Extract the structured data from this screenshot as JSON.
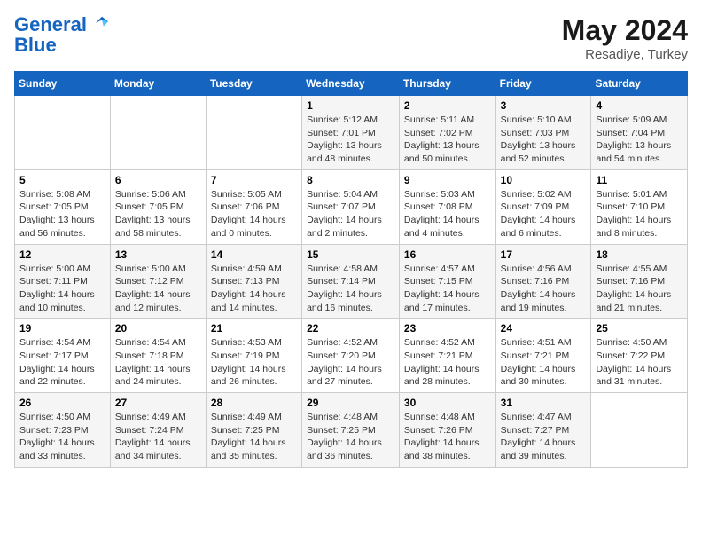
{
  "header": {
    "logo_line1": "General",
    "logo_line2": "Blue",
    "month": "May 2024",
    "location": "Resadiye, Turkey"
  },
  "weekdays": [
    "Sunday",
    "Monday",
    "Tuesday",
    "Wednesday",
    "Thursday",
    "Friday",
    "Saturday"
  ],
  "weeks": [
    [
      {
        "day": "",
        "info": ""
      },
      {
        "day": "",
        "info": ""
      },
      {
        "day": "",
        "info": ""
      },
      {
        "day": "1",
        "info": "Sunrise: 5:12 AM\nSunset: 7:01 PM\nDaylight: 13 hours\nand 48 minutes."
      },
      {
        "day": "2",
        "info": "Sunrise: 5:11 AM\nSunset: 7:02 PM\nDaylight: 13 hours\nand 50 minutes."
      },
      {
        "day": "3",
        "info": "Sunrise: 5:10 AM\nSunset: 7:03 PM\nDaylight: 13 hours\nand 52 minutes."
      },
      {
        "day": "4",
        "info": "Sunrise: 5:09 AM\nSunset: 7:04 PM\nDaylight: 13 hours\nand 54 minutes."
      }
    ],
    [
      {
        "day": "5",
        "info": "Sunrise: 5:08 AM\nSunset: 7:05 PM\nDaylight: 13 hours\nand 56 minutes."
      },
      {
        "day": "6",
        "info": "Sunrise: 5:06 AM\nSunset: 7:05 PM\nDaylight: 13 hours\nand 58 minutes."
      },
      {
        "day": "7",
        "info": "Sunrise: 5:05 AM\nSunset: 7:06 PM\nDaylight: 14 hours\nand 0 minutes."
      },
      {
        "day": "8",
        "info": "Sunrise: 5:04 AM\nSunset: 7:07 PM\nDaylight: 14 hours\nand 2 minutes."
      },
      {
        "day": "9",
        "info": "Sunrise: 5:03 AM\nSunset: 7:08 PM\nDaylight: 14 hours\nand 4 minutes."
      },
      {
        "day": "10",
        "info": "Sunrise: 5:02 AM\nSunset: 7:09 PM\nDaylight: 14 hours\nand 6 minutes."
      },
      {
        "day": "11",
        "info": "Sunrise: 5:01 AM\nSunset: 7:10 PM\nDaylight: 14 hours\nand 8 minutes."
      }
    ],
    [
      {
        "day": "12",
        "info": "Sunrise: 5:00 AM\nSunset: 7:11 PM\nDaylight: 14 hours\nand 10 minutes."
      },
      {
        "day": "13",
        "info": "Sunrise: 5:00 AM\nSunset: 7:12 PM\nDaylight: 14 hours\nand 12 minutes."
      },
      {
        "day": "14",
        "info": "Sunrise: 4:59 AM\nSunset: 7:13 PM\nDaylight: 14 hours\nand 14 minutes."
      },
      {
        "day": "15",
        "info": "Sunrise: 4:58 AM\nSunset: 7:14 PM\nDaylight: 14 hours\nand 16 minutes."
      },
      {
        "day": "16",
        "info": "Sunrise: 4:57 AM\nSunset: 7:15 PM\nDaylight: 14 hours\nand 17 minutes."
      },
      {
        "day": "17",
        "info": "Sunrise: 4:56 AM\nSunset: 7:16 PM\nDaylight: 14 hours\nand 19 minutes."
      },
      {
        "day": "18",
        "info": "Sunrise: 4:55 AM\nSunset: 7:16 PM\nDaylight: 14 hours\nand 21 minutes."
      }
    ],
    [
      {
        "day": "19",
        "info": "Sunrise: 4:54 AM\nSunset: 7:17 PM\nDaylight: 14 hours\nand 22 minutes."
      },
      {
        "day": "20",
        "info": "Sunrise: 4:54 AM\nSunset: 7:18 PM\nDaylight: 14 hours\nand 24 minutes."
      },
      {
        "day": "21",
        "info": "Sunrise: 4:53 AM\nSunset: 7:19 PM\nDaylight: 14 hours\nand 26 minutes."
      },
      {
        "day": "22",
        "info": "Sunrise: 4:52 AM\nSunset: 7:20 PM\nDaylight: 14 hours\nand 27 minutes."
      },
      {
        "day": "23",
        "info": "Sunrise: 4:52 AM\nSunset: 7:21 PM\nDaylight: 14 hours\nand 28 minutes."
      },
      {
        "day": "24",
        "info": "Sunrise: 4:51 AM\nSunset: 7:21 PM\nDaylight: 14 hours\nand 30 minutes."
      },
      {
        "day": "25",
        "info": "Sunrise: 4:50 AM\nSunset: 7:22 PM\nDaylight: 14 hours\nand 31 minutes."
      }
    ],
    [
      {
        "day": "26",
        "info": "Sunrise: 4:50 AM\nSunset: 7:23 PM\nDaylight: 14 hours\nand 33 minutes."
      },
      {
        "day": "27",
        "info": "Sunrise: 4:49 AM\nSunset: 7:24 PM\nDaylight: 14 hours\nand 34 minutes."
      },
      {
        "day": "28",
        "info": "Sunrise: 4:49 AM\nSunset: 7:25 PM\nDaylight: 14 hours\nand 35 minutes."
      },
      {
        "day": "29",
        "info": "Sunrise: 4:48 AM\nSunset: 7:25 PM\nDaylight: 14 hours\nand 36 minutes."
      },
      {
        "day": "30",
        "info": "Sunrise: 4:48 AM\nSunset: 7:26 PM\nDaylight: 14 hours\nand 38 minutes."
      },
      {
        "day": "31",
        "info": "Sunrise: 4:47 AM\nSunset: 7:27 PM\nDaylight: 14 hours\nand 39 minutes."
      },
      {
        "day": "",
        "info": ""
      }
    ]
  ]
}
